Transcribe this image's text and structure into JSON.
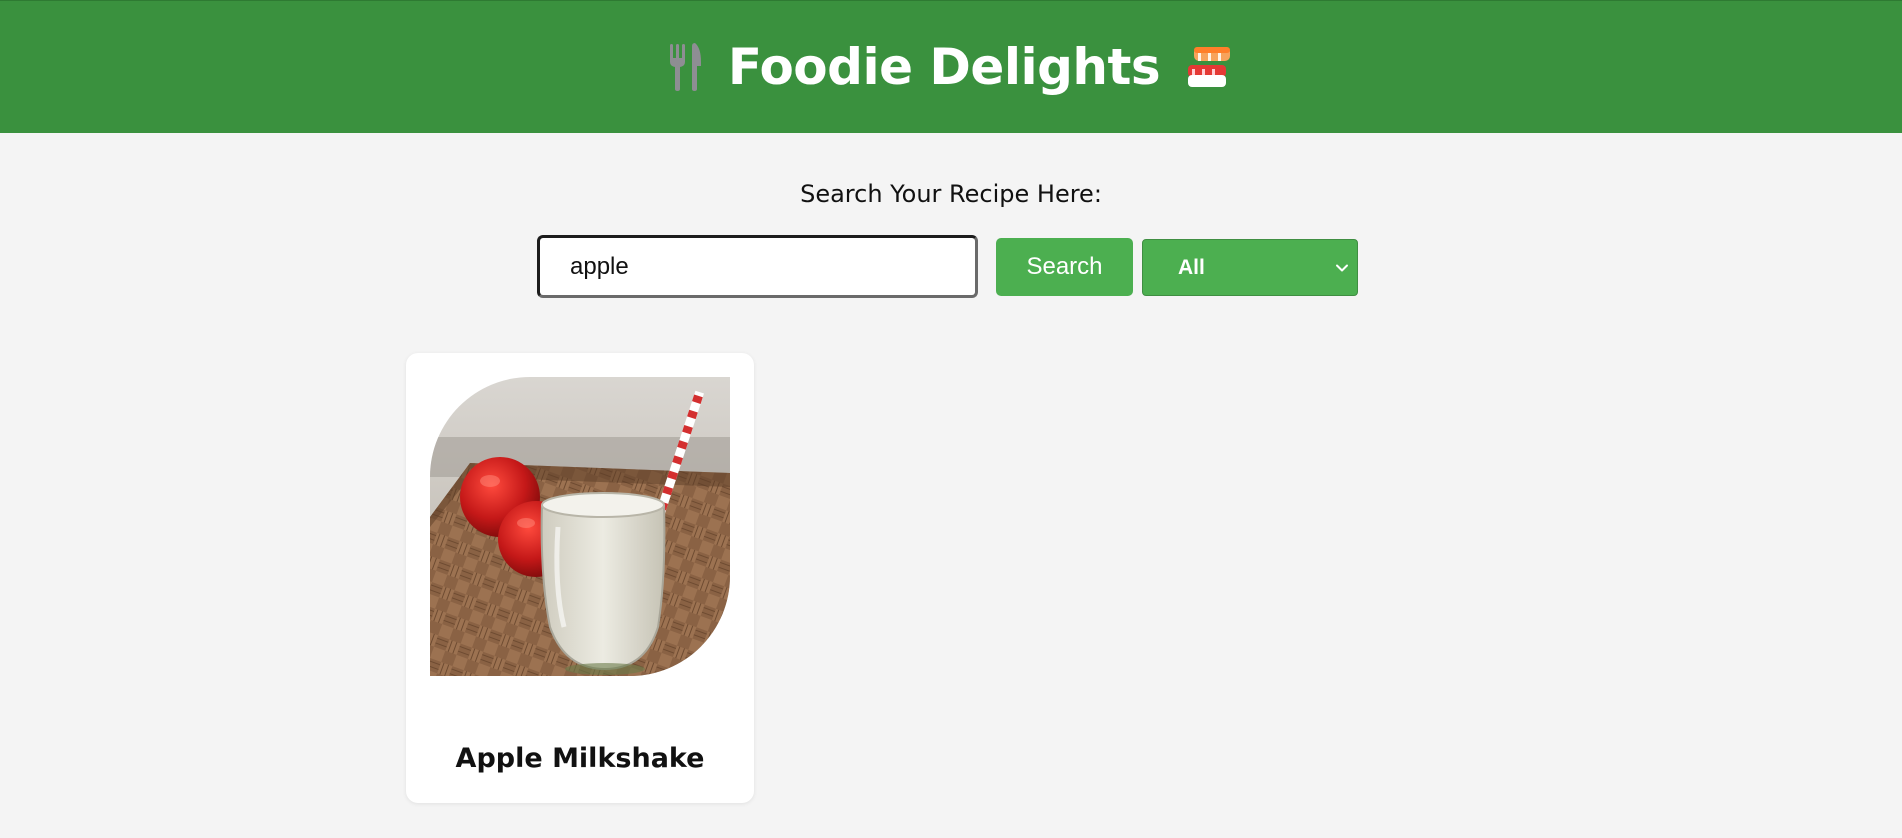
{
  "header": {
    "title": "Foodie Delights",
    "left_icon": "fork-knife-icon",
    "right_icon": "sushi-icon",
    "background": "#3a913e"
  },
  "search": {
    "label": "Search Your Recipe Here:",
    "input_value": "apple",
    "button_label": "Search",
    "category_selected": "All",
    "accent": "#4caf50"
  },
  "recipes": [
    {
      "title": "Apple Milkshake",
      "image": "apple-milkshake-photo"
    }
  ]
}
